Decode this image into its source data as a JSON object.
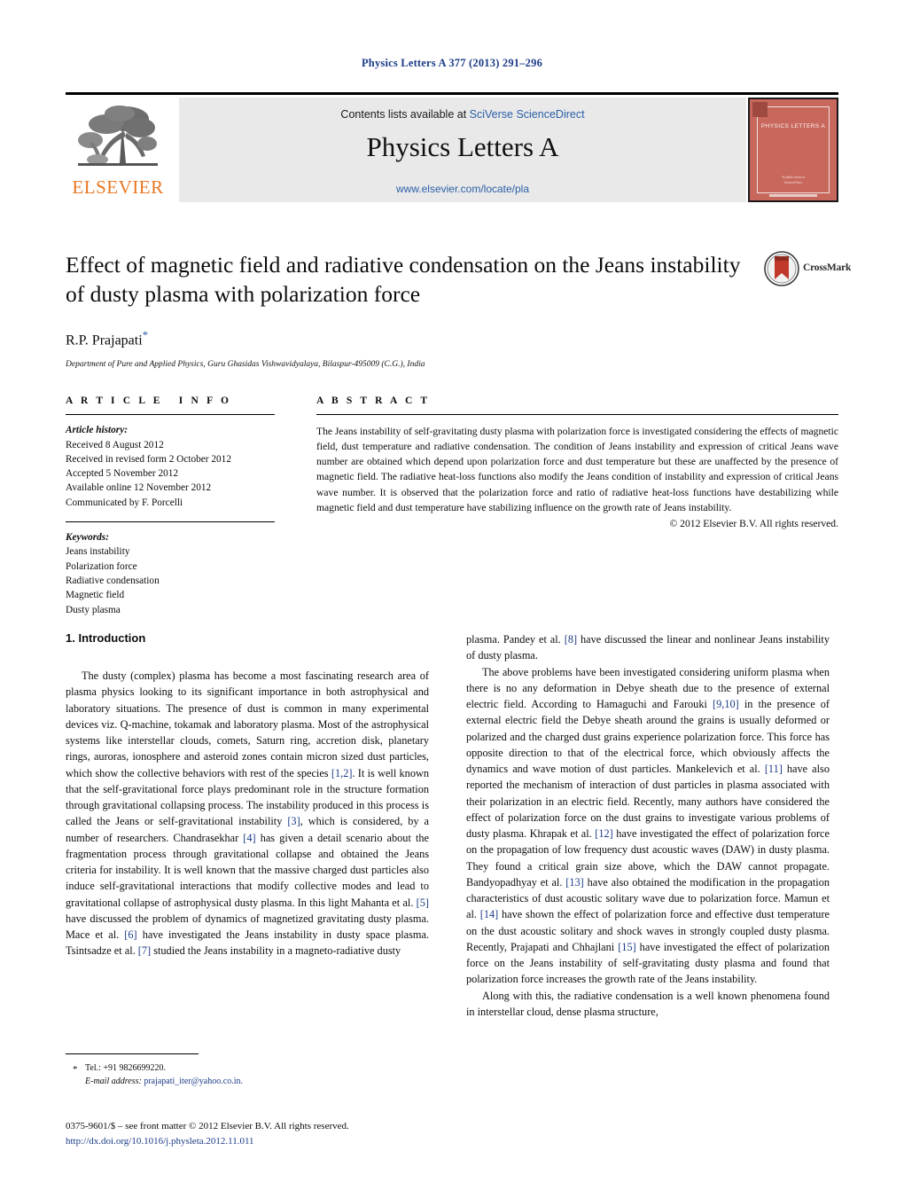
{
  "running_head": "Physics Letters A 377 (2013) 291–296",
  "masthead": {
    "contents_prefix": "Contents lists available at ",
    "sciencedirect": "SciVerse ScienceDirect",
    "journal_name": "Physics Letters A",
    "journal_url": "www.elsevier.com/locate/pla",
    "publisher_wordmark": "ELSEVIER",
    "cover": {
      "title": "PHYSICS LETTERS A",
      "footer_line1": "Avalable online at",
      "footer_line2": "ScienceDirect"
    }
  },
  "article": {
    "title": "Effect of magnetic field and radiative condensation on the Jeans instability of dusty plasma with polarization force",
    "author": "R.P. Prajapati",
    "author_marker": "*",
    "affiliation": "Department of Pure and Applied Physics, Guru Ghasidas Vishwavidyalaya, Bilaspur-495009 (C.G.), India",
    "crossmark_label": "CrossMark"
  },
  "info": {
    "heading": "A R T I C L E   I N F O",
    "history_label": "Article history:",
    "history": [
      "Received 8 August 2012",
      "Received in revised form 2 October 2012",
      "Accepted 5 November 2012",
      "Available online 12 November 2012",
      "Communicated by F. Porcelli"
    ],
    "keywords_label": "Keywords:",
    "keywords": [
      "Jeans instability",
      "Polarization force",
      "Radiative condensation",
      "Magnetic field",
      "Dusty plasma"
    ]
  },
  "abstract": {
    "heading": "A B S T R A C T",
    "text": "The Jeans instability of self-gravitating dusty plasma with polarization force is investigated considering the effects of magnetic field, dust temperature and radiative condensation. The condition of Jeans instability and expression of critical Jeans wave number are obtained which depend upon polarization force and dust temperature but these are unaffected by the presence of magnetic field. The radiative heat-loss functions also modify the Jeans condition of instability and expression of critical Jeans wave number. It is observed that the polarization force and ratio of radiative heat-loss functions have destabilizing while magnetic field and dust temperature have stabilizing influence on the growth rate of Jeans instability.",
    "copyright": "© 2012 Elsevier B.V. All rights reserved."
  },
  "body": {
    "section_heading": "1. Introduction",
    "left_paragraph": "The dusty (complex) plasma has become a most fascinating research area of plasma physics looking to its significant importance in both astrophysical and laboratory situations. The presence of dust is common in many experimental devices viz. Q-machine, tokamak and laboratory plasma. Most of the astrophysical systems like interstellar clouds, comets, Saturn ring, accretion disk, planetary rings, auroras, ionosphere and asteroid zones contain micron sized dust particles, which show the collective behaviors with rest of the species [1,2]. It is well known that the self-gravitational force plays predominant role in the structure formation through gravitational collapsing process. The instability produced in this process is called the Jeans or self-gravitational instability [3], which is considered, by a number of researchers. Chandrasekhar [4] has given a detail scenario about the fragmentation process through gravitational collapse and obtained the Jeans criteria for instability. It is well known that the massive charged dust particles also induce self-gravitational interactions that modify collective modes and lead to gravitational collapse of astrophysical dusty plasma. In this light Mahanta et al. [5] have discussed the problem of dynamics of magnetized gravitating dusty plasma. Mace et al. [6] have investigated the Jeans instability in dusty space plasma. Tsintsadze et al. [7] studied the Jeans instability in a magneto-radiative dusty",
    "right_paragraph_1": "plasma. Pandey et al. [8] have discussed the linear and nonlinear Jeans instability of dusty plasma.",
    "right_paragraph_2": "The above problems have been investigated considering uniform plasma when there is no any deformation in Debye sheath due to the presence of external electric field. According to Hamaguchi and Farouki [9,10] in the presence of external electric field the Debye sheath around the grains is usually deformed or polarized and the charged dust grains experience polarization force. This force has opposite direction to that of the electrical force, which obviously affects the dynamics and wave motion of dust particles. Mankelevich et al. [11] have also reported the mechanism of interaction of dust particles in plasma associated with their polarization in an electric field. Recently, many authors have considered the effect of polarization force on the dust grains to investigate various problems of dusty plasma. Khrapak et al. [12] have investigated the effect of polarization force on the propagation of low frequency dust acoustic waves (DAW) in dusty plasma. They found a critical grain size above, which the DAW cannot propagate. Bandyopadhyay et al. [13] have also obtained the modification in the propagation characteristics of dust acoustic solitary wave due to polarization force. Mamun et al. [14] have shown the effect of polarization force and effective dust temperature on the dust acoustic solitary and shock waves in strongly coupled dusty plasma. Recently, Prajapati and Chhajlani [15] have investigated the effect of polarization force on the Jeans instability of self-gravitating dusty plasma and found that polarization force increases the growth rate of the Jeans instability.",
    "right_paragraph_3": "Along with this, the radiative condensation is a well known phenomena found in interstellar cloud, dense plasma structure,"
  },
  "footnotes": {
    "tel_marker": "*",
    "tel": "Tel.: +91 9826699220.",
    "email_label": "E-mail address:",
    "email": "prajapati_iter@yahoo.co.in."
  },
  "issn_footer": {
    "line1": "0375-9601/$ – see front matter  © 2012 Elsevier B.V. All rights reserved.",
    "doi": "http://dx.doi.org/10.1016/j.physleta.2012.11.011"
  },
  "colors": {
    "header_blue": "#1b3b87",
    "link_blue": "#2b5fa8",
    "elsevier_orange": "#e87722",
    "cover_red": "#c8675c",
    "panel_gray": "#e9e9e9"
  }
}
